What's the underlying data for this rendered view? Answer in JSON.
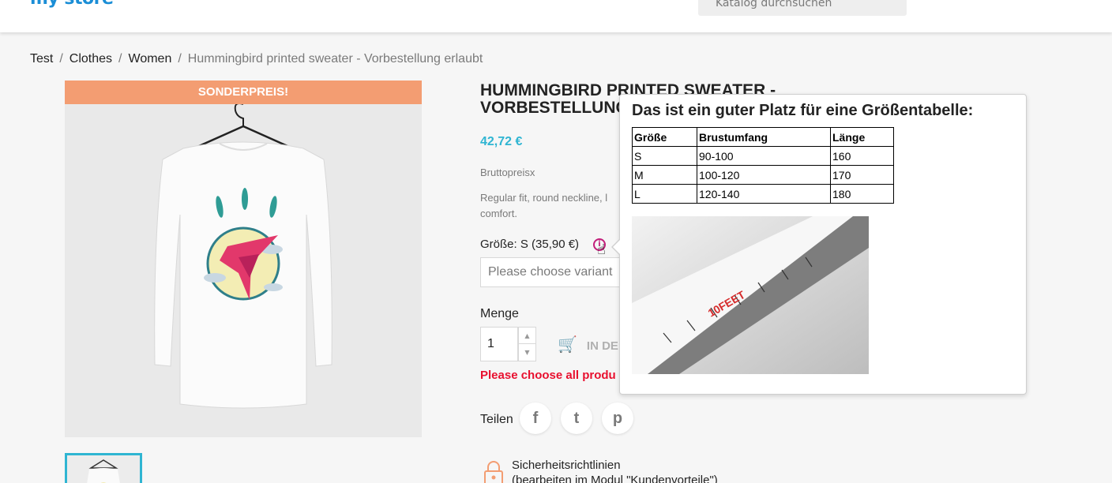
{
  "header": {
    "logo_text": "my store",
    "search_text": "Katalog durchsuchen"
  },
  "breadcrumb": [
    {
      "label": "Test"
    },
    {
      "label": "Clothes"
    },
    {
      "label": "Women"
    },
    {
      "label": "Hummingbird printed sweater - Vorbestellung erlaubt"
    }
  ],
  "product": {
    "flag": "SONDERPREIS!",
    "title_line1": "Hummingbird printed sweater -",
    "title_line2": "Vorbestellung",
    "price": "42,72 €",
    "tax_label": "Bruttopreisx",
    "description": "Regular fit, round neckline, l comfort.",
    "size_label": "Größe: S (35,90 €)",
    "variant_placeholder": "Please choose variant",
    "quantity_label": "Menge",
    "quantity_value": "1",
    "add_to_cart": "IN DE",
    "error_message": "Please choose all produ",
    "share_label": "Teilen",
    "social": [
      "f",
      "t",
      "p"
    ],
    "reassurance_line1": "Sicherheitsrichtlinien",
    "reassurance_line2": "(bearbeiten im Modul \"Kundenvorteile\")"
  },
  "popover": {
    "title": "Das ist ein guter Platz für eine Größentabelle:",
    "table": {
      "headers": [
        "Größe",
        "Brustumfang",
        "Länge"
      ],
      "rows": [
        [
          "S",
          "90-100",
          "160"
        ],
        [
          "M",
          "100-120",
          "170"
        ],
        [
          "L",
          "120-140",
          "180"
        ]
      ]
    },
    "tape_label": "10FEET"
  },
  "colors": {
    "accent": "#2fb5d2",
    "flag": "#f39d72",
    "error": "#e8102f",
    "info_icon": "#c21e7a"
  }
}
